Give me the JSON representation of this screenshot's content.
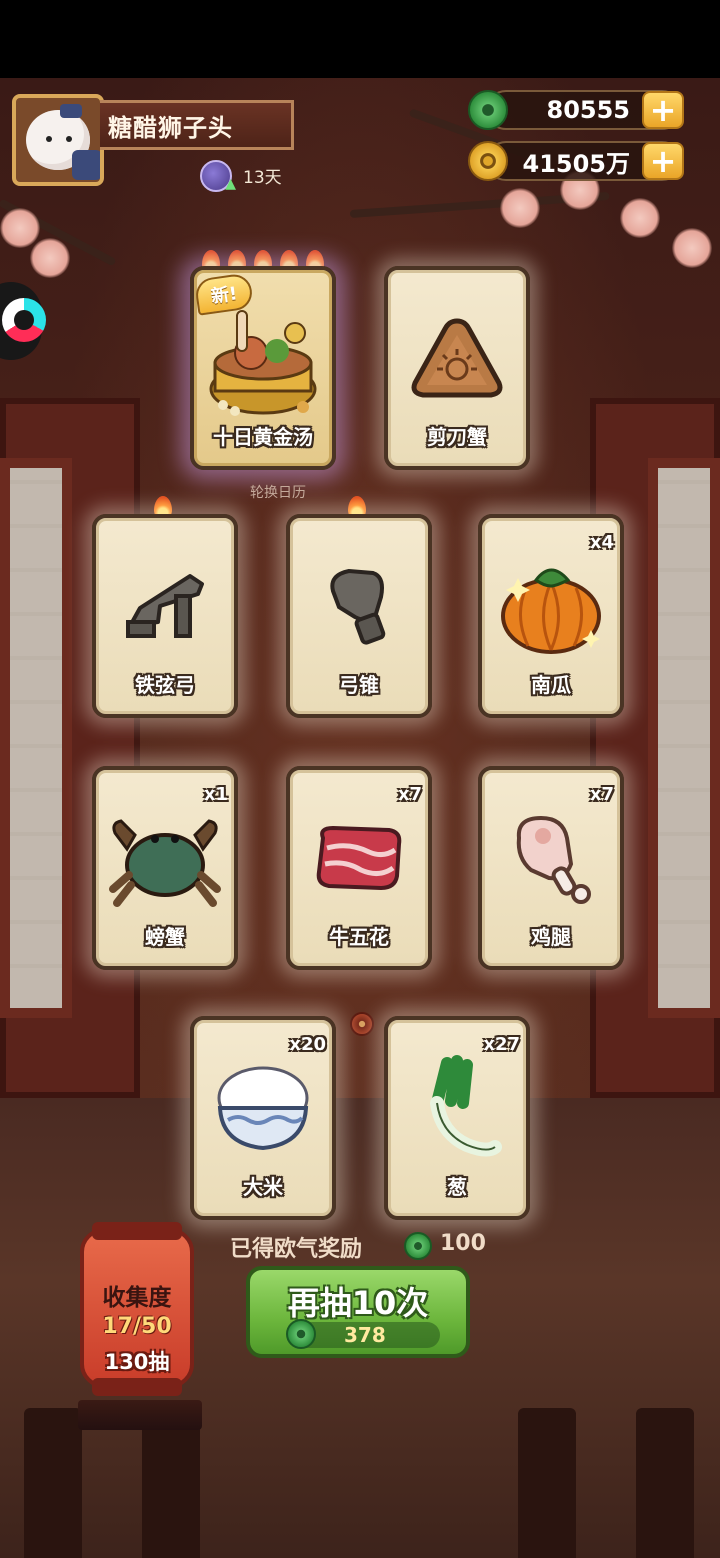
{
  "player": {
    "name": "糖醋狮子头",
    "days": "13天"
  },
  "currency": {
    "jade": "80555",
    "coins": "41505万",
    "jade_color": "#2f8f3d",
    "coin_color": "#d99a20"
  },
  "featured": {
    "new_tag": "新!",
    "caption": "轮换日历"
  },
  "cards": [
    {
      "name": "十日黄金汤",
      "count": "",
      "icon": "golden-soup-icon",
      "flames": 5,
      "is_new": true
    },
    {
      "name": "剪刀蟹",
      "count": "",
      "icon": "sandwich-triangle-icon",
      "flames": 0
    },
    {
      "name": "铁弦弓",
      "count": "",
      "icon": "iron-bow-icon",
      "flames": 1
    },
    {
      "name": "弓锥",
      "count": "",
      "icon": "awl-icon",
      "flames": 1
    },
    {
      "name": "南瓜",
      "count": "x4",
      "icon": "pumpkin-icon",
      "flames": 0
    },
    {
      "name": "螃蟹",
      "count": "x1",
      "icon": "crab-icon",
      "flames": 0
    },
    {
      "name": "牛五花",
      "count": "x7",
      "icon": "beef-icon",
      "flames": 0
    },
    {
      "name": "鸡腿",
      "count": "x7",
      "icon": "drumstick-icon",
      "flames": 0
    },
    {
      "name": "大米",
      "count": "x20",
      "icon": "rice-bowl-icon",
      "flames": 0
    },
    {
      "name": "葱",
      "count": "x27",
      "icon": "scallion-icon",
      "flames": 0
    }
  ],
  "reward": {
    "label": "已得欧气奖励",
    "value": "100"
  },
  "collection": {
    "title": "收集度",
    "progress": "17/50",
    "pulls": "130抽"
  },
  "draw_button": {
    "label": "再抽10次",
    "cost": "378"
  }
}
